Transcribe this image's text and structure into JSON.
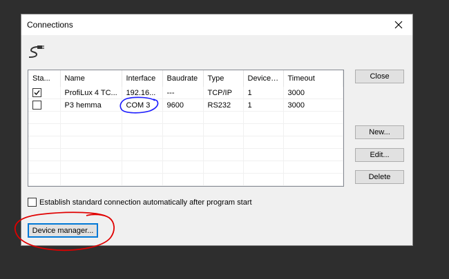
{
  "dialog": {
    "title": "Connections",
    "close_icon": "close-icon",
    "plug_icon": "plug-icon"
  },
  "grid": {
    "columns": [
      "Sta...",
      "Name",
      "Interface",
      "Baudrate",
      "Type",
      "Device ...",
      "Timeout"
    ],
    "rows": [
      {
        "checked": true,
        "name": "ProfiLux 4 TC...",
        "interface": "192.16...",
        "baudrate": "---",
        "type": "TCP/IP",
        "device": "1",
        "timeout": "3000"
      },
      {
        "checked": false,
        "name": "P3 hemma",
        "interface": "COM 3",
        "baudrate": "9600",
        "type": "RS232",
        "device": "1",
        "timeout": "3000"
      }
    ]
  },
  "buttons": {
    "close": "Close",
    "new": "New...",
    "edit": "Edit...",
    "delete": "Delete",
    "device_manager": "Device manager..."
  },
  "auto_connect": {
    "label": "Establish standard connection automatically after program start",
    "checked": false
  },
  "annotations": {
    "blue_circle_color": "#1a1aff",
    "red_circle_color": "#e00000"
  }
}
